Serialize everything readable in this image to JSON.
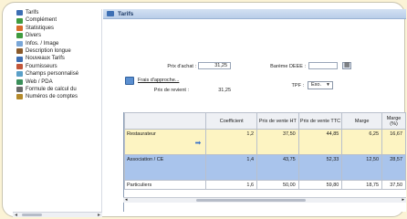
{
  "sidebar": {
    "items": [
      {
        "label": "Tarifs",
        "icon": "grid-icon",
        "color": "#3d6fb4"
      },
      {
        "label": "Complément",
        "icon": "green-gear-icon",
        "color": "#3f9b3f"
      },
      {
        "label": "Statistiques",
        "icon": "chart-icon",
        "color": "#d96b2b"
      },
      {
        "label": "Divers",
        "icon": "green-gear-icon",
        "color": "#3f9b3f"
      },
      {
        "label": "Infos. / Image",
        "icon": "image-icon",
        "color": "#7aa7d8"
      },
      {
        "label": "Description longue",
        "icon": "document-icon",
        "color": "#8a5a2b"
      },
      {
        "label": "Nouveaux Tarifs",
        "icon": "grid-icon",
        "color": "#3d6fb4"
      },
      {
        "label": "Fournisseurs",
        "icon": "users-icon",
        "color": "#c2563a"
      },
      {
        "label": "Champs personnalisé",
        "icon": "fields-icon",
        "color": "#5aa0c8"
      },
      {
        "label": "Web / PDA",
        "icon": "globe-icon",
        "color": "#3a8f5a"
      },
      {
        "label": "Formule de calcul du",
        "icon": "formula-icon",
        "color": "#6a6a6a"
      },
      {
        "label": "Numéros de comptes",
        "icon": "key-icon",
        "color": "#b48a2b"
      }
    ]
  },
  "panel": {
    "title": "Tarifs",
    "prix_achat_label": "Prix d'achat :",
    "prix_achat_value": "31,25",
    "frais_label": "Frais d'approche...",
    "prix_revient_label": "Prix de revient :",
    "prix_revient_value": "31,25",
    "bareme_label": "Barème DEEE :",
    "tpf_label": "TPF :",
    "tpf_value": "Exo."
  },
  "grid": {
    "columns": [
      "",
      "Coefficient",
      "Prix de vente HT",
      "Prix de vente TTC",
      "Marge",
      "Marge (%)"
    ],
    "rows": [
      {
        "label": "Restaurateur",
        "values": [
          "1,2",
          "37,50",
          "44,85",
          "6,25",
          "16,67"
        ]
      },
      {
        "label": "Association / CE",
        "values": [
          "1,4",
          "43,75",
          "52,33",
          "12,50",
          "28,57"
        ]
      },
      {
        "label": "Particuliers",
        "values": [
          "1,6",
          "50,00",
          "59,80",
          "18,75",
          "37,50"
        ]
      }
    ]
  }
}
